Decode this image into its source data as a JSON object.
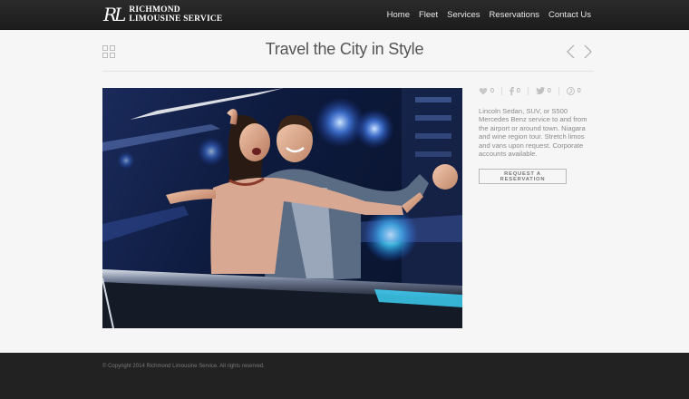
{
  "header": {
    "logo_monogram": "RL",
    "logo_line1": "RICHMOND",
    "logo_line2": "LIMOUSINE SERVICE",
    "nav": [
      "Home",
      "Fleet",
      "Services",
      "Reservations",
      "Contact Us"
    ]
  },
  "page": {
    "title": "Travel the City in Style"
  },
  "social": {
    "likes": "0",
    "facebook": "0",
    "twitter": "0",
    "pinterest": "0"
  },
  "description": "Lincoln Sedan, SUV, or S500 Mercedes Benz service to and from the airport or around town. Niagara and wine region tour. Stretch limos and vans upon request. Corporate accounts available.",
  "cta": {
    "label": "REQUEST A RESERVATION"
  },
  "footer": {
    "copyright": "© Copyright 2014 Richmond Limousine Service. All rights reserved."
  },
  "colors": {
    "header_bg": "#222222",
    "page_bg": "#f6f6f6",
    "footer_bg": "#222222",
    "title": "#555555"
  }
}
